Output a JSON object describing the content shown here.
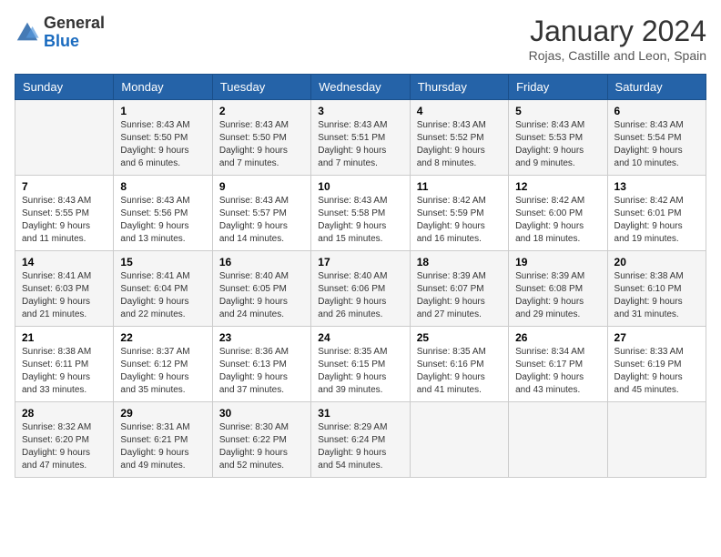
{
  "header": {
    "logo": {
      "general": "General",
      "blue": "Blue"
    },
    "title": "January 2024",
    "location": "Rojas, Castille and Leon, Spain"
  },
  "weekdays": [
    "Sunday",
    "Monday",
    "Tuesday",
    "Wednesday",
    "Thursday",
    "Friday",
    "Saturday"
  ],
  "weeks": [
    [
      {
        "day": "",
        "sunrise": "",
        "sunset": "",
        "daylight": ""
      },
      {
        "day": "1",
        "sunrise": "Sunrise: 8:43 AM",
        "sunset": "Sunset: 5:50 PM",
        "daylight": "Daylight: 9 hours and 6 minutes."
      },
      {
        "day": "2",
        "sunrise": "Sunrise: 8:43 AM",
        "sunset": "Sunset: 5:50 PM",
        "daylight": "Daylight: 9 hours and 7 minutes."
      },
      {
        "day": "3",
        "sunrise": "Sunrise: 8:43 AM",
        "sunset": "Sunset: 5:51 PM",
        "daylight": "Daylight: 9 hours and 7 minutes."
      },
      {
        "day": "4",
        "sunrise": "Sunrise: 8:43 AM",
        "sunset": "Sunset: 5:52 PM",
        "daylight": "Daylight: 9 hours and 8 minutes."
      },
      {
        "day": "5",
        "sunrise": "Sunrise: 8:43 AM",
        "sunset": "Sunset: 5:53 PM",
        "daylight": "Daylight: 9 hours and 9 minutes."
      },
      {
        "day": "6",
        "sunrise": "Sunrise: 8:43 AM",
        "sunset": "Sunset: 5:54 PM",
        "daylight": "Daylight: 9 hours and 10 minutes."
      }
    ],
    [
      {
        "day": "7",
        "sunrise": "Sunrise: 8:43 AM",
        "sunset": "Sunset: 5:55 PM",
        "daylight": "Daylight: 9 hours and 11 minutes."
      },
      {
        "day": "8",
        "sunrise": "Sunrise: 8:43 AM",
        "sunset": "Sunset: 5:56 PM",
        "daylight": "Daylight: 9 hours and 13 minutes."
      },
      {
        "day": "9",
        "sunrise": "Sunrise: 8:43 AM",
        "sunset": "Sunset: 5:57 PM",
        "daylight": "Daylight: 9 hours and 14 minutes."
      },
      {
        "day": "10",
        "sunrise": "Sunrise: 8:43 AM",
        "sunset": "Sunset: 5:58 PM",
        "daylight": "Daylight: 9 hours and 15 minutes."
      },
      {
        "day": "11",
        "sunrise": "Sunrise: 8:42 AM",
        "sunset": "Sunset: 5:59 PM",
        "daylight": "Daylight: 9 hours and 16 minutes."
      },
      {
        "day": "12",
        "sunrise": "Sunrise: 8:42 AM",
        "sunset": "Sunset: 6:00 PM",
        "daylight": "Daylight: 9 hours and 18 minutes."
      },
      {
        "day": "13",
        "sunrise": "Sunrise: 8:42 AM",
        "sunset": "Sunset: 6:01 PM",
        "daylight": "Daylight: 9 hours and 19 minutes."
      }
    ],
    [
      {
        "day": "14",
        "sunrise": "Sunrise: 8:41 AM",
        "sunset": "Sunset: 6:03 PM",
        "daylight": "Daylight: 9 hours and 21 minutes."
      },
      {
        "day": "15",
        "sunrise": "Sunrise: 8:41 AM",
        "sunset": "Sunset: 6:04 PM",
        "daylight": "Daylight: 9 hours and 22 minutes."
      },
      {
        "day": "16",
        "sunrise": "Sunrise: 8:40 AM",
        "sunset": "Sunset: 6:05 PM",
        "daylight": "Daylight: 9 hours and 24 minutes."
      },
      {
        "day": "17",
        "sunrise": "Sunrise: 8:40 AM",
        "sunset": "Sunset: 6:06 PM",
        "daylight": "Daylight: 9 hours and 26 minutes."
      },
      {
        "day": "18",
        "sunrise": "Sunrise: 8:39 AM",
        "sunset": "Sunset: 6:07 PM",
        "daylight": "Daylight: 9 hours and 27 minutes."
      },
      {
        "day": "19",
        "sunrise": "Sunrise: 8:39 AM",
        "sunset": "Sunset: 6:08 PM",
        "daylight": "Daylight: 9 hours and 29 minutes."
      },
      {
        "day": "20",
        "sunrise": "Sunrise: 8:38 AM",
        "sunset": "Sunset: 6:10 PM",
        "daylight": "Daylight: 9 hours and 31 minutes."
      }
    ],
    [
      {
        "day": "21",
        "sunrise": "Sunrise: 8:38 AM",
        "sunset": "Sunset: 6:11 PM",
        "daylight": "Daylight: 9 hours and 33 minutes."
      },
      {
        "day": "22",
        "sunrise": "Sunrise: 8:37 AM",
        "sunset": "Sunset: 6:12 PM",
        "daylight": "Daylight: 9 hours and 35 minutes."
      },
      {
        "day": "23",
        "sunrise": "Sunrise: 8:36 AM",
        "sunset": "Sunset: 6:13 PM",
        "daylight": "Daylight: 9 hours and 37 minutes."
      },
      {
        "day": "24",
        "sunrise": "Sunrise: 8:35 AM",
        "sunset": "Sunset: 6:15 PM",
        "daylight": "Daylight: 9 hours and 39 minutes."
      },
      {
        "day": "25",
        "sunrise": "Sunrise: 8:35 AM",
        "sunset": "Sunset: 6:16 PM",
        "daylight": "Daylight: 9 hours and 41 minutes."
      },
      {
        "day": "26",
        "sunrise": "Sunrise: 8:34 AM",
        "sunset": "Sunset: 6:17 PM",
        "daylight": "Daylight: 9 hours and 43 minutes."
      },
      {
        "day": "27",
        "sunrise": "Sunrise: 8:33 AM",
        "sunset": "Sunset: 6:19 PM",
        "daylight": "Daylight: 9 hours and 45 minutes."
      }
    ],
    [
      {
        "day": "28",
        "sunrise": "Sunrise: 8:32 AM",
        "sunset": "Sunset: 6:20 PM",
        "daylight": "Daylight: 9 hours and 47 minutes."
      },
      {
        "day": "29",
        "sunrise": "Sunrise: 8:31 AM",
        "sunset": "Sunset: 6:21 PM",
        "daylight": "Daylight: 9 hours and 49 minutes."
      },
      {
        "day": "30",
        "sunrise": "Sunrise: 8:30 AM",
        "sunset": "Sunset: 6:22 PM",
        "daylight": "Daylight: 9 hours and 52 minutes."
      },
      {
        "day": "31",
        "sunrise": "Sunrise: 8:29 AM",
        "sunset": "Sunset: 6:24 PM",
        "daylight": "Daylight: 9 hours and 54 minutes."
      },
      {
        "day": "",
        "sunrise": "",
        "sunset": "",
        "daylight": ""
      },
      {
        "day": "",
        "sunrise": "",
        "sunset": "",
        "daylight": ""
      },
      {
        "day": "",
        "sunrise": "",
        "sunset": "",
        "daylight": ""
      }
    ]
  ]
}
